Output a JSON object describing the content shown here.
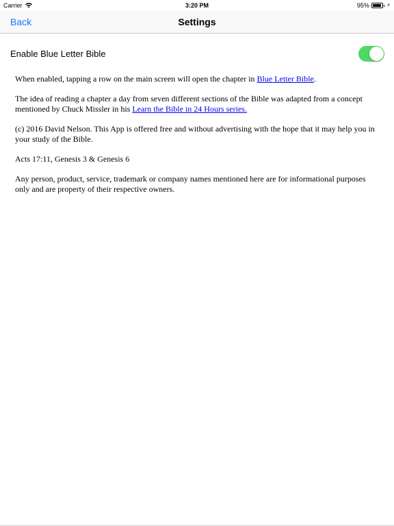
{
  "status_bar": {
    "carrier": "Carrier",
    "time": "3:20 PM",
    "battery_percent_label": "95%",
    "battery_level": 0.95,
    "icons": [
      "wifi-icon",
      "battery-icon",
      "charging-icon"
    ]
  },
  "nav": {
    "back_label": "Back",
    "title": "Settings",
    "accent_color": "#0a7aff"
  },
  "settings": {
    "toggle_label": "Enable Blue Letter Bible",
    "toggle_on": true,
    "toggle_color": "#4cd964"
  },
  "content": {
    "p1_text": "When enabled, tapping a row on the main screen will open the chapter in ",
    "p1_link": "Blue Letter Bible",
    "p1_end": ".",
    "p2_text": "The idea of reading a chapter a day from seven different sections of the Bible was adapted from a concept mentioned by Chuck Missler in his ",
    "p2_link": "Learn the Bible in 24 Hours series.",
    "p3": "(c) 2016 David Nelson. This App is offered free and without advertising with the hope that it may help you in your study of the Bible.",
    "p4": "Acts 17:11, Genesis 3 & Genesis 6",
    "p5": "Any person, product, service, trademark or company names mentioned here are for informational purposes only and are property of their respective owners.",
    "link_color": "#0000ee"
  }
}
